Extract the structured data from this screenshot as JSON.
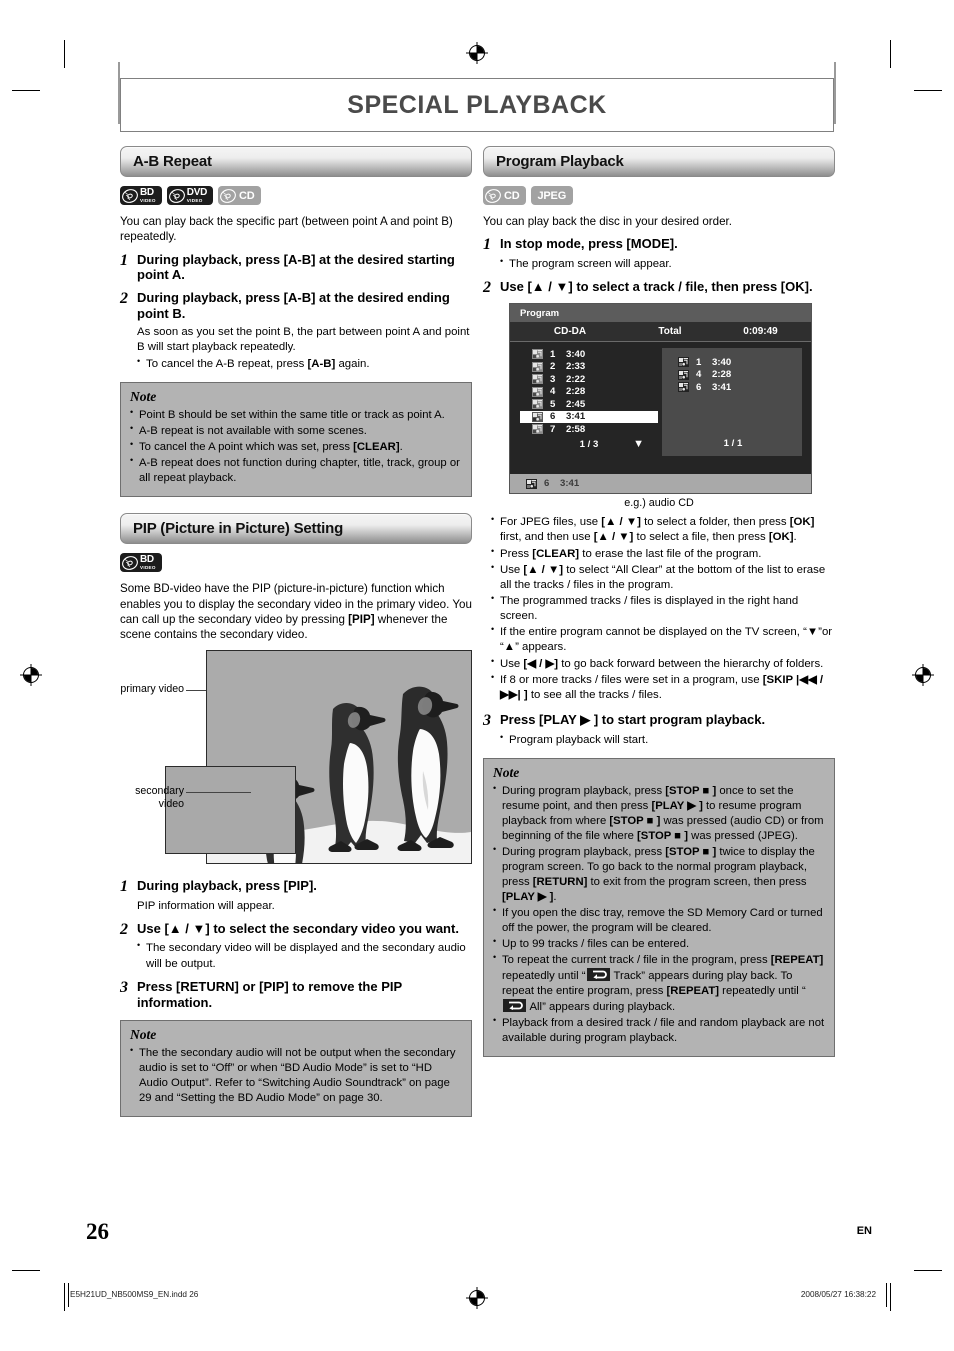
{
  "page": {
    "title": "SPECIAL PLAYBACK",
    "number": "26",
    "lang_mark": "EN",
    "footer_left": "E5H21UD_NB500MS9_EN.indd   26",
    "footer_right": "2008/05/27   16:38:22"
  },
  "sections": {
    "ab_repeat": {
      "heading": "A-B Repeat",
      "badges": [
        {
          "kind": "disc",
          "line1": "BD",
          "line2": "VIDEO",
          "style": "dark",
          "name": "bd-video-badge"
        },
        {
          "kind": "disc",
          "line1": "DVD",
          "line2": "VIDEO",
          "style": "dark",
          "name": "dvd-video-badge"
        },
        {
          "kind": "disc",
          "line1": "CD",
          "line2": "",
          "style": "gray",
          "name": "cd-badge"
        }
      ],
      "intro": "You can play back the specific part (between point A and point B) repeatedly.",
      "steps": [
        {
          "num": "1",
          "text": "During playback, press [A-B] at the desired starting point A."
        },
        {
          "num": "2",
          "text": "During playback, press [A-B] at the desired ending point B."
        }
      ],
      "step2_sub": "As soon as you set the point B, the part between point A and point B will start playback repeatedly.",
      "step2_bullet": "To cancel the A-B repeat, press [A-B] again.",
      "note_heading": "Note",
      "notes": [
        "Point B should be set within the same title or track as point A.",
        "A-B repeat is not available with some scenes.",
        "To cancel the A point which was set, press [CLEAR].",
        "A-B repeat does not function during chapter, title, track, group or all repeat playback."
      ]
    },
    "pip": {
      "heading": "PIP (Picture in Picture) Setting",
      "badges": [
        {
          "kind": "disc",
          "line1": "BD",
          "line2": "VIDEO",
          "style": "dark",
          "name": "bd-video-badge"
        }
      ],
      "intro": "Some BD-video have the PIP (picture-in-picture) function which enables you to display the secondary video in the primary video. You can call up the secondary video by pressing [PIP] whenever the scene contains the secondary video.",
      "figure": {
        "label_primary": "primary video",
        "label_secondary": "secondary video"
      },
      "steps": [
        {
          "num": "1",
          "text": "During playback, press [PIP]."
        },
        {
          "num": "2",
          "text": "Use [▲ / ▼] to select the secondary video you want."
        },
        {
          "num": "3",
          "text": "Press [RETURN] or [PIP] to remove the PIP information."
        }
      ],
      "step1_sub": "PIP information will appear.",
      "step2_bullet": "The secondary video will be displayed and the secondary audio will be output.",
      "note_heading": "Note",
      "notes": [
        "The the secondary audio will not be output when the secondary audio is set to “Off” or when “BD Audio Mode” is set to “HD Audio Output”. Refer to “Switching Audio Soundtrack” on page 29 and “Setting the BD Audio Mode” on page 30."
      ]
    },
    "program": {
      "heading": "Program Playback",
      "badges": [
        {
          "kind": "disc",
          "line1": "CD",
          "line2": "",
          "style": "gray",
          "name": "cd-badge"
        },
        {
          "kind": "plain",
          "line1": "JPEG",
          "line2": "",
          "style": "gray",
          "name": "jpeg-badge"
        }
      ],
      "intro": "You can play back the disc in your desired order.",
      "steps": [
        {
          "num": "1",
          "text": "In stop mode, press [MODE]."
        },
        {
          "num": "2",
          "text": "Use [▲ / ▼] to select a track / file, then press [OK]."
        },
        {
          "num": "3",
          "text": "Press [PLAY ▶ ] to start program playback."
        }
      ],
      "step1_sub": "The program screen will appear.",
      "step3_sub": "Program playback will start.",
      "figure_caption": "e.g.) audio CD",
      "bullets": [
        "For JPEG files, use [▲ / ▼] to select a folder, then press [OK] first, and then use [▲ / ▼] to select a file, then press [OK].",
        "Press [CLEAR] to erase the last file of the program.",
        "Use [▲ / ▼] to select “All Clear” at the bottom of the list to erase all the tracks / files in the program.",
        "The programmed tracks / files is displayed in the right hand screen.",
        "If the entire program cannot be displayed on the TV screen, “▼”or “▲” appears.",
        "Use [◀ / ▶] to go back forward between the hierarchy of folders.",
        "If 8 or more tracks / files were set in a program, use [SKIP |◀◀ / ▶▶| ] to see all the tracks / files."
      ],
      "note_heading": "Note",
      "notes": [
        "During program playback, press [STOP ■ ] once to set the resume point, and then press [PLAY ▶ ] to resume program playback from where [STOP ■ ] was pressed (audio CD) or from beginning of the file where [STOP ■ ] was pressed (JPEG).",
        "During program playback, press [STOP ■ ] twice to display the program screen. To go back to the normal program playback, press [RETURN] to exit from the program screen, then press [PLAY ▶ ].",
        "If you open the disc tray, remove the SD Memory Card or turned off the power, the program will be cleared.",
        "Up to 99 tracks / files can be entered.",
        "To repeat the current track / file in the program, press [REPEAT] repeatedly until “  Track” appears during play back. To repeat the entire program, press [REPEAT] repeatedly until “  All” appears during playback.",
        "Playback from a desired track / file and random playback are not available during program playback."
      ]
    }
  },
  "osd": {
    "window_title": "Program",
    "disc_type": "CD-DA",
    "total_label": "Total",
    "total_time": "0:09:49",
    "left_list": [
      {
        "no": "1",
        "time": "3:40",
        "selected": false
      },
      {
        "no": "2",
        "time": "2:33",
        "selected": false
      },
      {
        "no": "3",
        "time": "2:22",
        "selected": false
      },
      {
        "no": "4",
        "time": "2:28",
        "selected": false
      },
      {
        "no": "5",
        "time": "2:45",
        "selected": false
      },
      {
        "no": "6",
        "time": "3:41",
        "selected": true
      },
      {
        "no": "7",
        "time": "2:58",
        "selected": false
      }
    ],
    "left_page": "1 /  3",
    "right_list": [
      {
        "no": "1",
        "time": "3:40"
      },
      {
        "no": "4",
        "time": "2:28"
      },
      {
        "no": "6",
        "time": "3:41"
      }
    ],
    "right_page": "1 /  1",
    "status_row": {
      "no": "6",
      "time": "3:41"
    }
  }
}
